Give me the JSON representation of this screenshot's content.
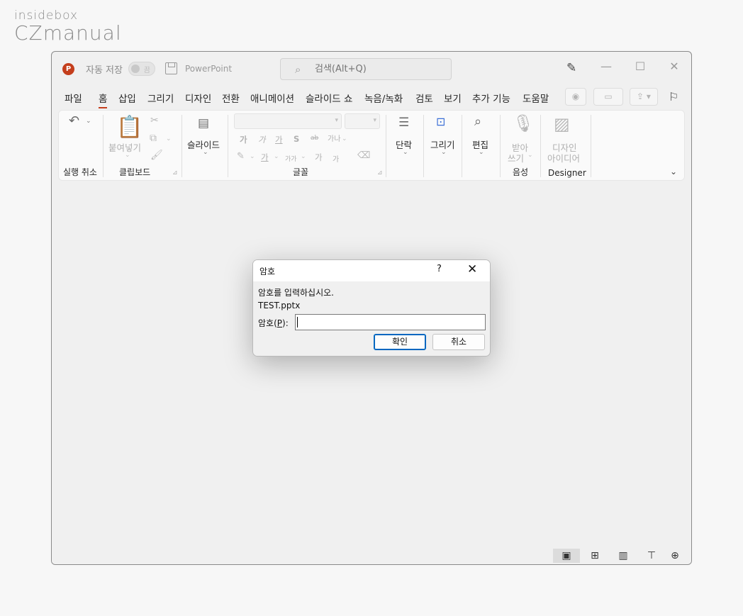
{
  "watermark": {
    "line1": "insidebox",
    "line2": "CZmanual"
  },
  "titlebar": {
    "app_icon_letter": "P",
    "autosave_label": "자동 저장",
    "autosave_state": "끔",
    "doc_title": "PowerPoint",
    "search_placeholder": "검색(Alt+Q)"
  },
  "tabs": [
    "파일",
    "홈",
    "삽입",
    "그리기",
    "디자인",
    "전환",
    "애니메이션",
    "슬라이드 쇼",
    "녹음/녹화",
    "검토",
    "보기",
    "추가 기능",
    "도움말"
  ],
  "active_tab": "홈",
  "ribbon": {
    "undo_group": "실행 취소",
    "clipboard": {
      "paste": "붙여넣기",
      "group": "클립보드"
    },
    "slides": {
      "label": "슬라이드"
    },
    "font": {
      "group": "글꼴",
      "row1": [
        "가",
        "가",
        "가",
        "S",
        "ab",
        "가나"
      ],
      "row2": [
        "가",
        "가가",
        "가",
        "가"
      ]
    },
    "paragraph": {
      "label": "단락"
    },
    "drawing": {
      "label": "그리기"
    },
    "editing": {
      "label": "편집"
    },
    "voice": {
      "dictate_line1": "받아",
      "dictate_line2": "쓰기",
      "group": "음성"
    },
    "designer": {
      "line1": "디자인",
      "line2": "아이디어",
      "group": "Designer"
    }
  },
  "dialog": {
    "title": "암호",
    "help": "?",
    "message": "암호를 입력하십시오.",
    "filename": "TEST.pptx",
    "password_label_prefix": "암호(",
    "password_label_key": "P",
    "password_label_suffix": "):",
    "password_value": "",
    "ok_label": "확인",
    "cancel_label": "취소"
  }
}
